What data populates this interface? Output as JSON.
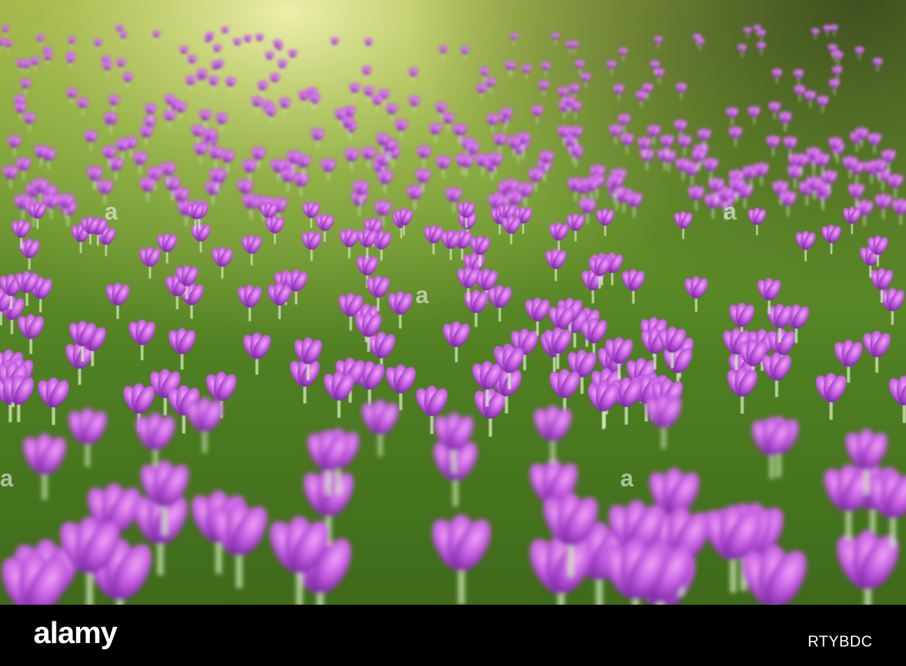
{
  "watermark": {
    "text": "a"
  },
  "footer": {
    "brand": "alamy",
    "image_id": "RTYBDC"
  },
  "colors": {
    "grass": "#5e8a2a",
    "grass_light": "#a9c24a",
    "crocus": "#b34cd6",
    "crocus_light": "#e48cf0",
    "sunlight": "#f2f4a8"
  }
}
